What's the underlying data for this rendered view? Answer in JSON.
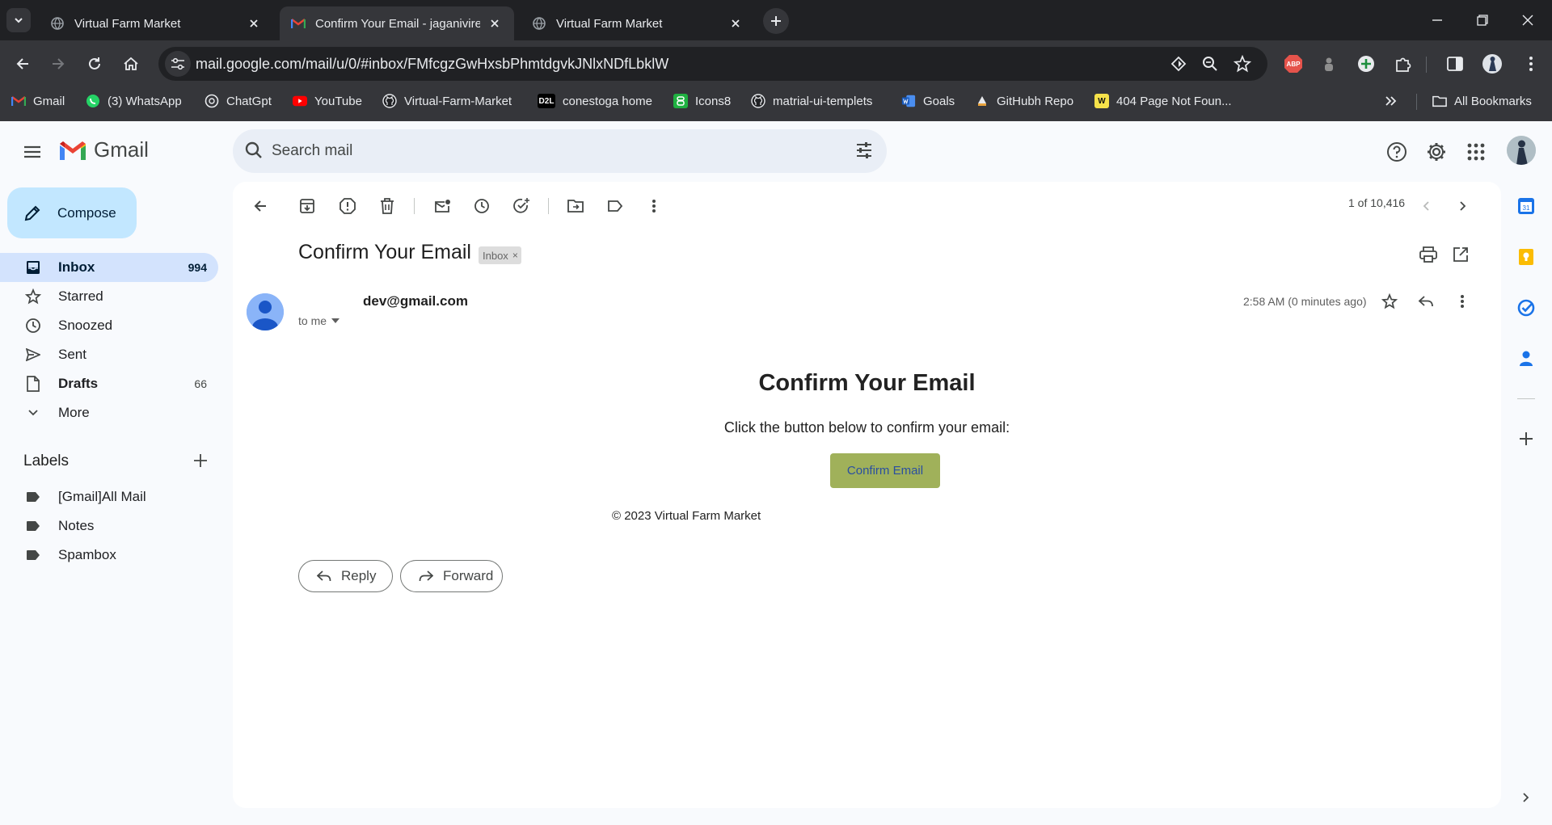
{
  "browser": {
    "tabs": [
      {
        "title": "Virtual Farm Market",
        "active": false
      },
      {
        "title": "Confirm Your Email - jaganivire",
        "active": true
      },
      {
        "title": "Virtual Farm Market",
        "active": false
      }
    ],
    "url": "mail.google.com/mail/u/0/#inbox/FMfcgzGwHxsbPhmtdgvkJNlxNDfLbklW",
    "bookmarks": [
      {
        "label": "Gmail",
        "icon": "gmail-icon"
      },
      {
        "label": "(3) WhatsApp",
        "icon": "whatsapp-icon"
      },
      {
        "label": "ChatGpt",
        "icon": "chatgpt-icon"
      },
      {
        "label": "YouTube",
        "icon": "youtube-icon"
      },
      {
        "label": "Virtual-Farm-Market",
        "icon": "github-icon"
      },
      {
        "label": "conestoga home",
        "icon": "d2l-icon"
      },
      {
        "label": "Icons8",
        "icon": "icons8-icon"
      },
      {
        "label": "matrial-ui-templets",
        "icon": "github-icon"
      },
      {
        "label": "Goals",
        "icon": "word-icon"
      },
      {
        "label": "GitHubh Repo",
        "icon": "repo-icon"
      },
      {
        "label": "404 Page Not Foun...",
        "icon": "w-icon"
      }
    ],
    "all_bookmarks": "All Bookmarks",
    "ext_abp": "ABP",
    "bm_d2l": "D2L",
    "bm_w": "W"
  },
  "gmail": {
    "logo_text": "Gmail",
    "search_placeholder": "Search mail",
    "compose_label": "Compose",
    "nav": [
      {
        "label": "Inbox",
        "count": "994",
        "active": true
      },
      {
        "label": "Starred",
        "count": "",
        "active": false
      },
      {
        "label": "Snoozed",
        "count": "",
        "active": false
      },
      {
        "label": "Sent",
        "count": "",
        "active": false
      },
      {
        "label": "Drafts",
        "count": "66",
        "active": false
      },
      {
        "label": "More",
        "count": "",
        "active": false
      }
    ],
    "labels_heading": "Labels",
    "labels": [
      "[Gmail]All Mail",
      "Notes",
      "Spambox"
    ],
    "page_count": "1 of 10,416"
  },
  "message": {
    "subject": "Confirm Your Email",
    "chip": "Inbox",
    "chip_close": "×",
    "sender": "dev@gmail.com",
    "recipient": "to me",
    "time": "2:58 AM (0 minutes ago)",
    "body_title": "Confirm Your Email",
    "body_text": "Click the button below to confirm your email:",
    "button_label": "Confirm Email",
    "footer": "© 2023 Virtual Farm Market",
    "reply_label": "Reply",
    "forward_label": "Forward"
  },
  "colors": {
    "chrome_dark": "#202124",
    "chrome_toolbar": "#35363a",
    "compose_bg": "#c2e7ff",
    "nav_active_bg": "#d3e3fd",
    "confirm_button_bg": "#a0b15a"
  }
}
